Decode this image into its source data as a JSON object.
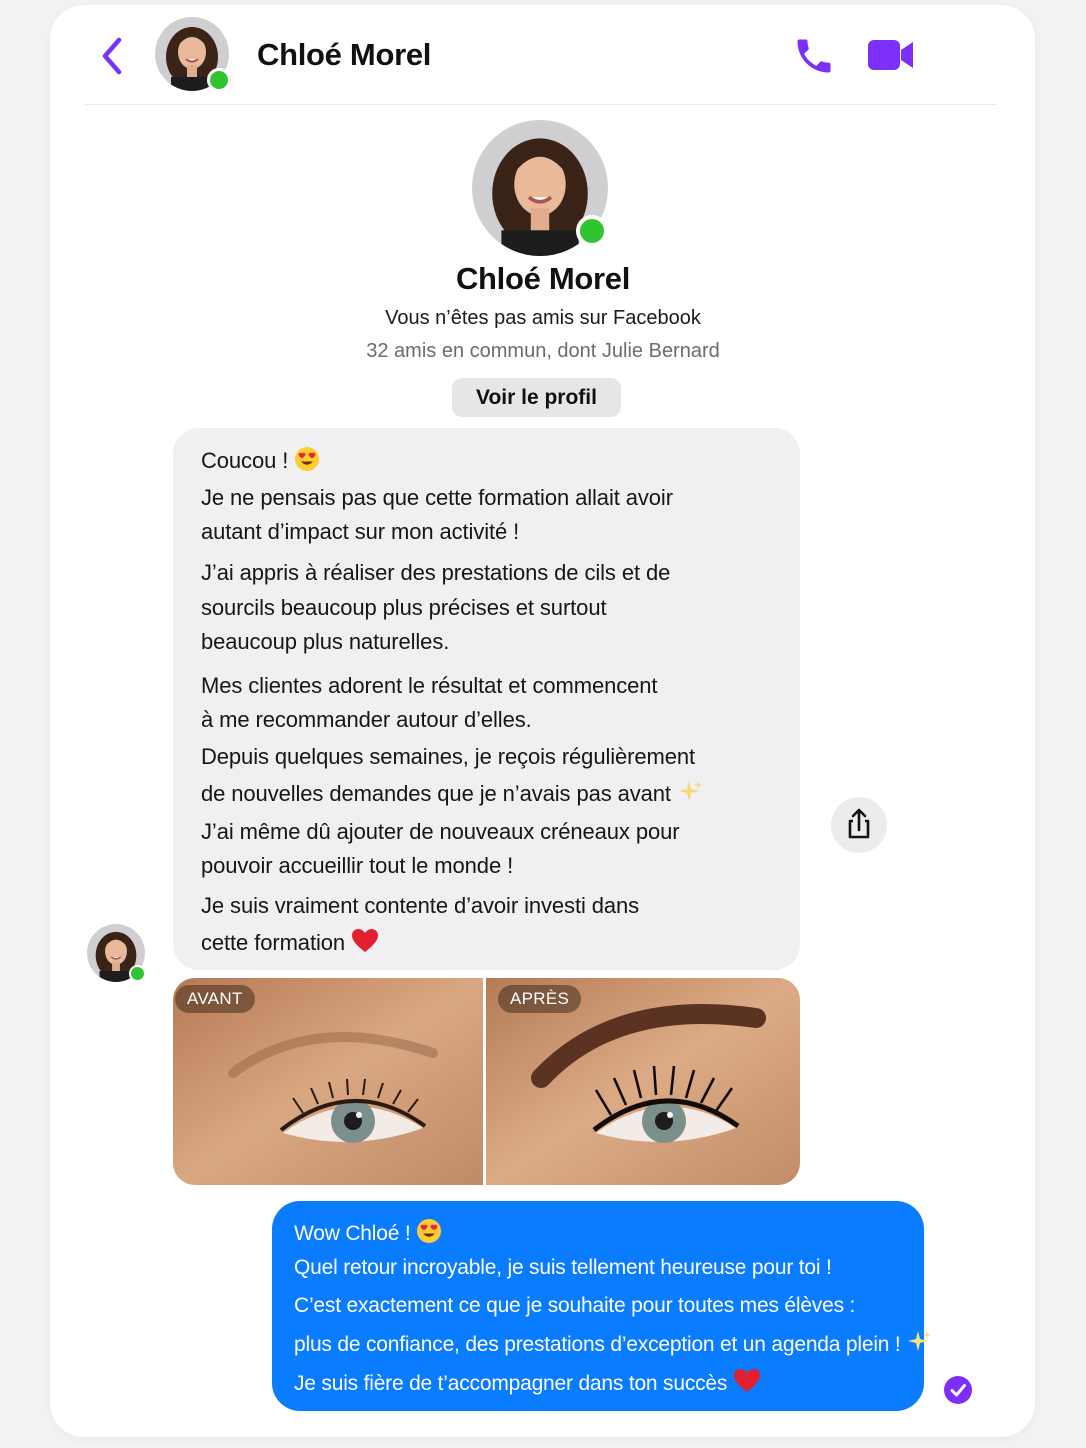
{
  "header": {
    "back_icon": "chevron-left-icon",
    "contact_name": "Chloé Morel",
    "call_icon": "phone-icon",
    "video_icon": "video-camera-icon",
    "accent_color": "#7b2ff7",
    "online_color": "#31c431"
  },
  "profile": {
    "name": "Chloé Morel",
    "relation": "Vous n’êtes pas amis sur Facebook",
    "mutual": "32 amis en commun, dont Julie Bernard",
    "view_button": "Voir le profil"
  },
  "incoming": {
    "lines": [
      "Coucou !",
      "Je ne pensais pas que cette formation allait avoir",
      "autant d’impact sur mon activité !",
      "J’ai appris à réaliser des prestations de cils et de",
      "sourcils beaucoup plus précises et surtout",
      "beaucoup plus naturelles.",
      "Mes clientes adorent le résultat et commencent",
      "à me recommander autour d’elles.",
      "Depuis quelques semaines, je reçois régulièrement",
      "de nouvelles demandes que je n’avais pas avant",
      "J’ai même dû ajouter de nouveaux créneaux pour",
      "pouvoir accueillir tout le monde !",
      "Je suis vraiment contente d’avoir investi dans",
      "cette formation"
    ],
    "bubble_color": "#f0f0f2"
  },
  "share_icon": "share-icon",
  "photos": {
    "before_label": "AVANT",
    "after_label": "APRÈS"
  },
  "outgoing": {
    "lines": [
      "Wow Chloé !",
      "Quel retour incroyable, je suis tellement heureuse pour toi !",
      "C’est exactement ce que je souhaite pour toutes mes élèves :",
      "plus de confiance, des prestations d’exception et un agenda plein !",
      "Je suis fière de t’accompagner dans ton succès"
    ],
    "bubble_color": "#0a7cff"
  },
  "seen_icon": "check-circle-icon"
}
